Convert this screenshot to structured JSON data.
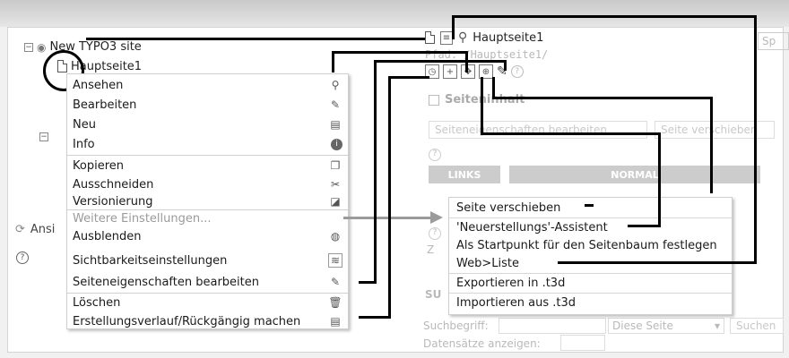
{
  "tree": {
    "root_label": "New TYPO3 site",
    "selected_page": "Hauptseite1"
  },
  "context_menu": [
    {
      "label": "Ansehen",
      "icon": "magnifier-icon"
    },
    {
      "label": "Bearbeiten",
      "icon": "edit-icon"
    },
    {
      "label": "Neu",
      "icon": "new-record-icon"
    },
    {
      "label": "Info",
      "icon": "info-icon"
    },
    {
      "label": "Kopieren",
      "icon": "copy-icon"
    },
    {
      "label": "Ausschneiden",
      "icon": "scissors-icon"
    },
    {
      "label": "Versionierung",
      "icon": "versioning-icon"
    },
    {
      "label": "Weitere Einstellungen...",
      "icon": ""
    },
    {
      "label": "Ausblenden",
      "icon": "hide-icon"
    },
    {
      "label": "Sichtbarkeitseinstellungen",
      "icon": "visibility-icon"
    },
    {
      "label": "Seiteneigenschaften bearbeiten",
      "icon": "pencil-icon"
    },
    {
      "label": "Löschen",
      "icon": "trash-icon"
    },
    {
      "label": "Erstellungsverlauf/Rückgängig machen",
      "icon": "history-icon"
    }
  ],
  "submenu": [
    {
      "label": "Seite verschieben"
    },
    {
      "label": "'Neuerstellungs'-Assistent"
    },
    {
      "label": "Als Startpunkt für den Seitenbaum festlegen"
    },
    {
      "label": "Web>Liste"
    },
    {
      "label": "Exportieren in .t3d"
    },
    {
      "label": "Importieren aus .t3d"
    }
  ],
  "right": {
    "page_title": "Hauptseite1",
    "path": "Pfad: /Hauptseite1/",
    "section": "Seiteninhalt",
    "btn_edit_props": "Seiteneigenschaften bearbeiten",
    "btn_move": "Seite verschieben",
    "col_links": "LINKS",
    "col_normal": "NORMAL",
    "search_label": "Suchbegriff:",
    "search_scope": "Diese Seite",
    "search_button": "Suchen",
    "show_records": "Datensätze anzeigen:",
    "sp_partial": "Sp",
    "su_partial": "SU",
    "z_partial": "Z"
  },
  "left_partial": "Ansi"
}
